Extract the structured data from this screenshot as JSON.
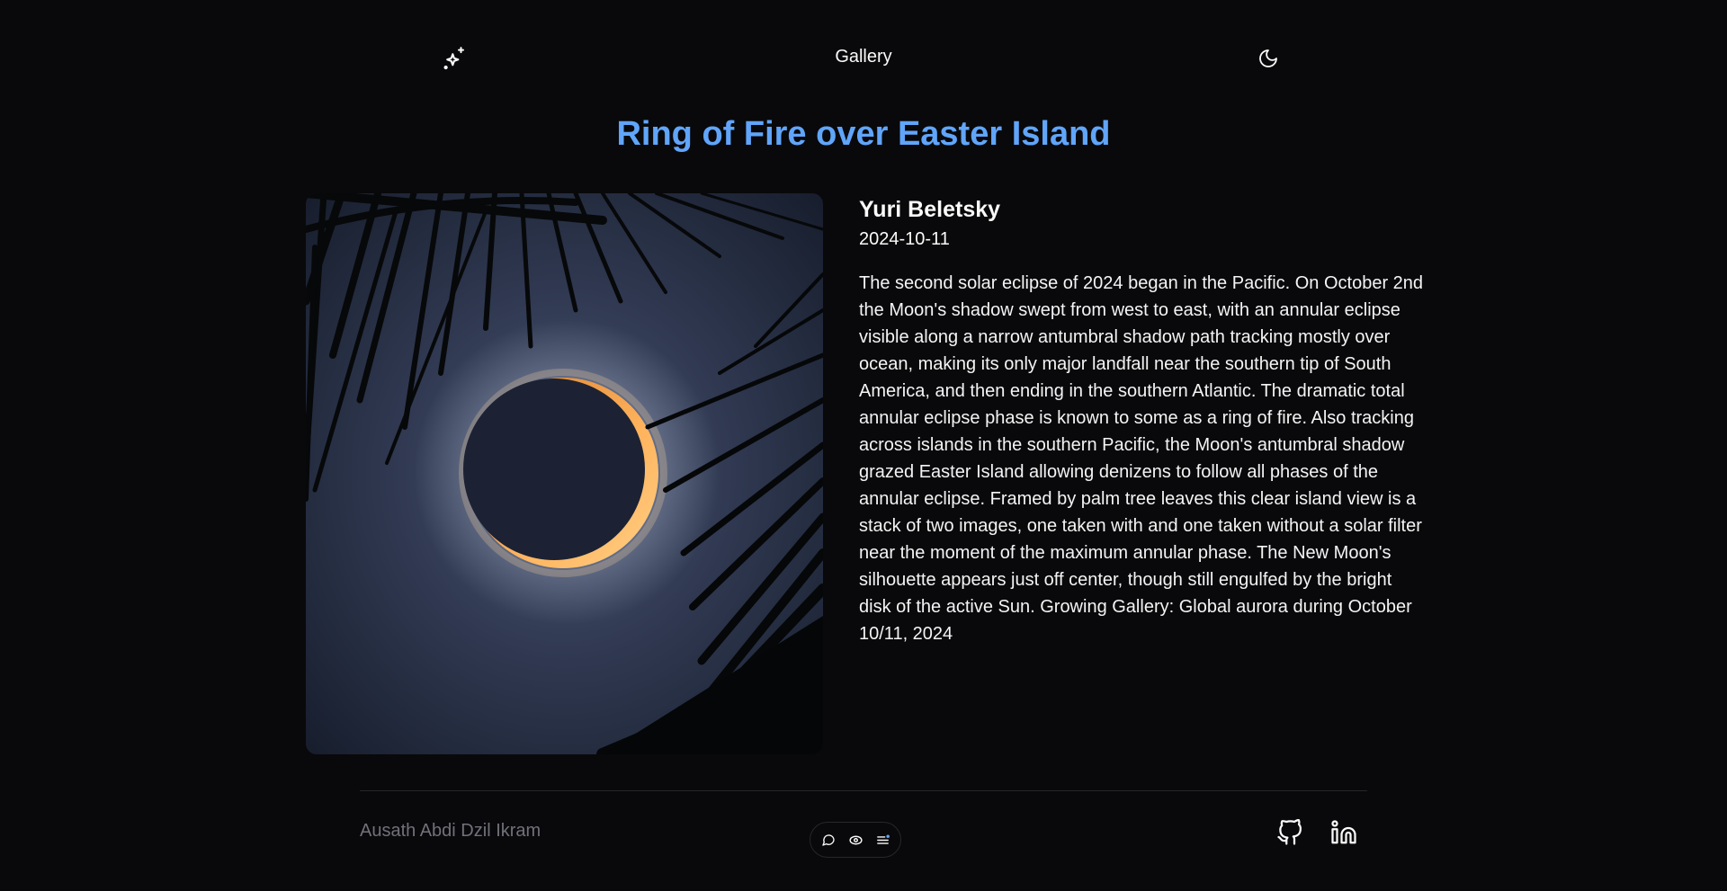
{
  "header": {
    "logo_icon": "sparkles-icon",
    "nav_label": "Gallery",
    "theme_icon": "moon-icon"
  },
  "title": "Ring of Fire over Easter Island",
  "image": {
    "description_icon": "eclipse-photo"
  },
  "author": "Yuri Beletsky",
  "date": "2024-10-11",
  "description": "The second solar eclipse of 2024 began in the Pacific. On October 2nd the Moon's shadow swept from west to east, with an annular eclipse visible along a narrow antumbral shadow path tracking mostly over ocean, making its only major landfall near the southern tip of South America, and then ending in the southern Atlantic. The dramatic total annular eclipse phase is known to some as a ring of fire. Also tracking across islands in the southern Pacific, the Moon's antumbral shadow grazed Easter Island allowing denizens to follow all phases of the annular eclipse. Framed by palm tree leaves this clear island view is a stack of two images, one taken with and one taken without a solar filter near the moment of the maximum annular phase. The New Moon's silhouette appears just off center, though still engulfed by the bright disk of the active Sun. Growing Gallery: Global aurora during October 10/11, 2024",
  "footer": {
    "name": "Ausath Abdi Dzil Ikram",
    "toolbar_icons": [
      "chat-bubble-icon",
      "eye-icon",
      "menu-lines-icon"
    ],
    "social_icons": [
      "github-icon",
      "linkedin-icon"
    ]
  },
  "colors": {
    "background": "#09090b",
    "title": "#60a5fa",
    "muted": "#71717a",
    "ring": "#f5a04a"
  }
}
